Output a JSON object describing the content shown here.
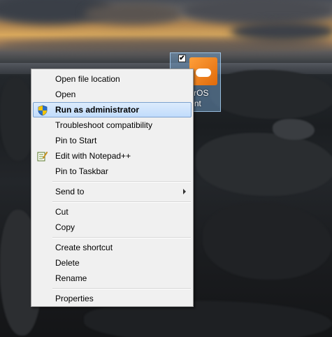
{
  "desktop": {
    "icon": {
      "label": "nterOS\nent",
      "checked": true,
      "checkmark": "✔"
    }
  },
  "context_menu": {
    "items": [
      {
        "label": "Open file location"
      },
      {
        "label": "Open"
      },
      {
        "label": "Run as administrator",
        "bold": true,
        "highlighted": true,
        "icon": "uac-shield-icon"
      },
      {
        "label": "Troubleshoot compatibility"
      },
      {
        "label": "Pin to Start"
      },
      {
        "label": "Edit with Notepad++",
        "icon": "notepad-plus-plus-icon"
      },
      {
        "label": "Pin to Taskbar"
      },
      {
        "label": "Send to",
        "submenu": true
      },
      {
        "label": "Cut"
      },
      {
        "label": "Copy"
      },
      {
        "label": "Create shortcut"
      },
      {
        "label": "Delete"
      },
      {
        "label": "Rename"
      },
      {
        "label": "Properties"
      }
    ]
  },
  "colors": {
    "highlight_border": "#7da2ce",
    "menu_background": "#f0f0f0"
  }
}
